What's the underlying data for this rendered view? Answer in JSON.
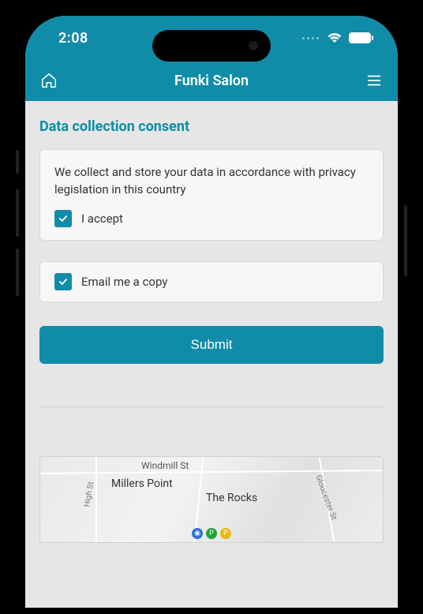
{
  "status": {
    "time": "2:08"
  },
  "header": {
    "title": "Funki Salon",
    "home_icon": "home-icon",
    "menu_icon": "menu-icon"
  },
  "page": {
    "section_title": "Data collection consent",
    "consent_card": {
      "text": "We collect and store your data in accordance with privacy legislation in this country",
      "checkbox_label": "I accept",
      "checked": true
    },
    "email_card": {
      "checkbox_label": "Email me a copy",
      "checked": true
    },
    "submit_label": "Submit"
  },
  "map": {
    "labels": {
      "windmill": "Windmill St",
      "millers": "Millers Point",
      "rocks": "The Rocks",
      "high": "High St",
      "gloucester": "Gloucester St"
    }
  },
  "colors": {
    "accent": "#118ca8"
  }
}
